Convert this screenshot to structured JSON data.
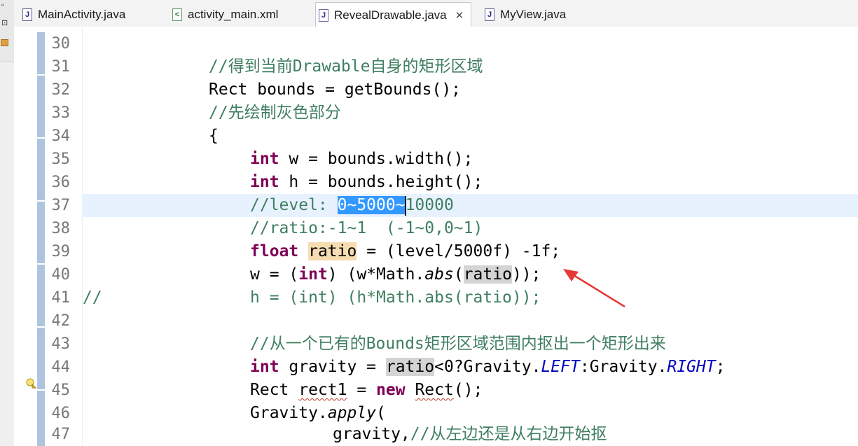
{
  "tabs": [
    {
      "label": "MainActivity.java",
      "icon": "java-file-icon",
      "active": false
    },
    {
      "label": "activity_main.xml",
      "icon": "xml-file-icon",
      "active": false
    },
    {
      "label": "RevealDrawable.java",
      "icon": "java-file-icon",
      "active": true,
      "close": "✕"
    },
    {
      "label": "MyView.java",
      "icon": "java-file-icon",
      "active": false
    }
  ],
  "editor": {
    "current_line": 37,
    "lines": [
      {
        "n": "30"
      },
      {
        "n": "31",
        "text": "//得到当前Drawable自身的矩形区域"
      },
      {
        "n": "32",
        "text": "Rect bounds = getBounds();"
      },
      {
        "n": "33",
        "text": "//先绘制灰色部分"
      },
      {
        "n": "34",
        "text": "{"
      },
      {
        "n": "35",
        "kw": "int",
        "text": " w = bounds.width();"
      },
      {
        "n": "36",
        "kw": "int",
        "text": " h = bounds.height();"
      },
      {
        "n": "37",
        "pre": "//level: ",
        "selected": "0~5000~",
        "post": "10000"
      },
      {
        "n": "38",
        "text": "//ratio:-1~1  (-1~0,0~1)"
      },
      {
        "n": "39",
        "kw": "float",
        "var": "ratio",
        "text": " = (level/5000f) -1f;"
      },
      {
        "n": "40",
        "text1": "w = (",
        "kw": "int",
        "text2": ") (w*Math.",
        "method": "abs",
        "text3": "(",
        "var": "ratio",
        "text4": "));"
      },
      {
        "n": "41",
        "prefix": "//",
        "text": "h = (int) (h*Math.abs(ratio));"
      },
      {
        "n": "42"
      },
      {
        "n": "43",
        "text": "//从一个已有的Bounds矩形区域范围内抠出一个矩形出来"
      },
      {
        "n": "44",
        "kw": "int",
        "text1": " gravity = ",
        "var": "ratio",
        "text2": "<0?Gravity.",
        "const1": "LEFT",
        "text3": ":Gravity.",
        "const2": "RIGHT",
        "text4": ";"
      },
      {
        "n": "45",
        "text1": "Rect ",
        "var": "rect1",
        "text2": " = ",
        "kw": "new",
        "text3": " ",
        "type": "Rect",
        "text4": "();"
      },
      {
        "n": "46",
        "text1": "Gravity.",
        "method": "apply",
        "text2": "("
      },
      {
        "n": "47",
        "text1": "gravity,",
        "comment": "//从左边还是从右边开始抠"
      }
    ]
  },
  "colors": {
    "keyword": "#7f0055",
    "comment": "#3f7f5f",
    "static_field": "#0000c0",
    "selection": "#3399ff",
    "current_line": "#e8f2fe",
    "annotation_arrow": "#e53935"
  }
}
